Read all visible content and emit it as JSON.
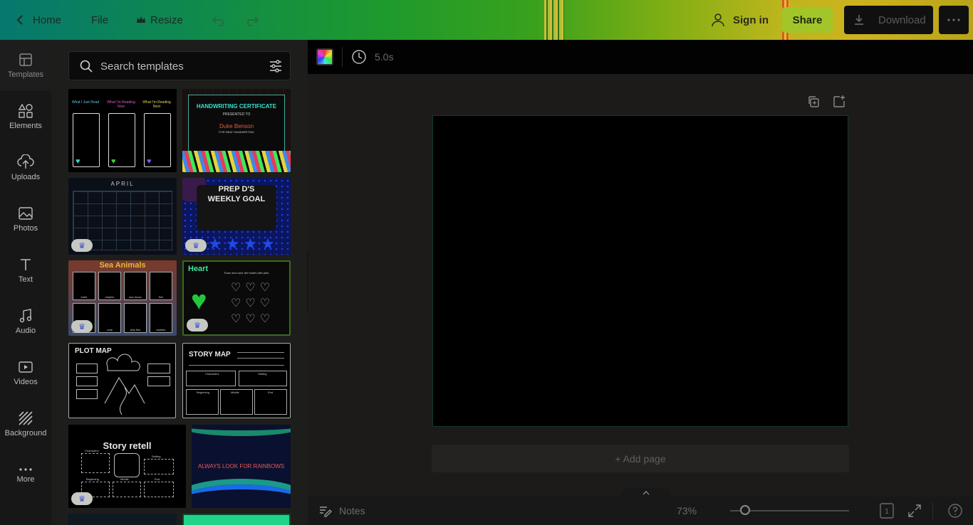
{
  "topbar": {
    "home_label": "Home",
    "file_label": "File",
    "resize_label": "Resize",
    "signin_label": "Sign in",
    "share_label": "Share",
    "download_label": "Download",
    "colors": {
      "share_bg": "#a2c52a",
      "download_bg": "#101010"
    }
  },
  "rail": {
    "items": [
      {
        "label": "Templates",
        "icon": "templates-icon"
      },
      {
        "label": "Elements",
        "icon": "elements-icon"
      },
      {
        "label": "Uploads",
        "icon": "upload-icon"
      },
      {
        "label": "Photos",
        "icon": "photos-icon"
      },
      {
        "label": "Text",
        "icon": "text-icon"
      },
      {
        "label": "Audio",
        "icon": "audio-icon"
      },
      {
        "label": "Videos",
        "icon": "videos-icon"
      },
      {
        "label": "Background",
        "icon": "background-icon"
      },
      {
        "label": "More",
        "icon": "more-icon"
      }
    ]
  },
  "panel": {
    "search_placeholder": "Search templates",
    "templates": {
      "reading": {
        "col1": "What I Just Read",
        "col2": "What I'm Reading Now",
        "col3": "What I'm Reading Next"
      },
      "certificate": {
        "title": "HANDWRITING CERTIFICATE",
        "presented": "PRESENTED TO",
        "name": "Duke Benson",
        "for": "FOR NEAT HANDWRITING"
      },
      "calendar": {
        "month": "APRIL"
      },
      "weekly_goal": {
        "line1": "PREP D'S",
        "line2": "WEEKLY GOAL"
      },
      "sea_animals": {
        "title": "Sea Animals",
        "labels": [
          "turtle",
          "dolphin",
          "sea horse",
          "fish",
          "octopus",
          "crab",
          "jelly fish",
          "starfish"
        ]
      },
      "heart": {
        "title": "Heart",
        "instruction": "Trace and color the hearts with pink."
      },
      "plot_map": {
        "title": "PLOT MAP"
      },
      "story_map": {
        "title": "STORY MAP",
        "characters": "Characters",
        "setting": "Setting",
        "beginning": "Beginning",
        "middle": "Middle",
        "end": "End"
      },
      "story_retell": {
        "title": "Story retell",
        "characters": "Characters",
        "setting": "Setting",
        "beginning": "Beginning",
        "middle": "Middle",
        "end": "End"
      },
      "rainbows": {
        "text": "ALWAYS LOOK FOR RAINBOWS"
      }
    }
  },
  "context_bar": {
    "duration": "5.0s"
  },
  "canvas": {
    "add_page_label": "+ Add page"
  },
  "status": {
    "notes_label": "Notes",
    "zoom_label": "73%",
    "zoom_level_percent": 73,
    "page_count": "1"
  }
}
